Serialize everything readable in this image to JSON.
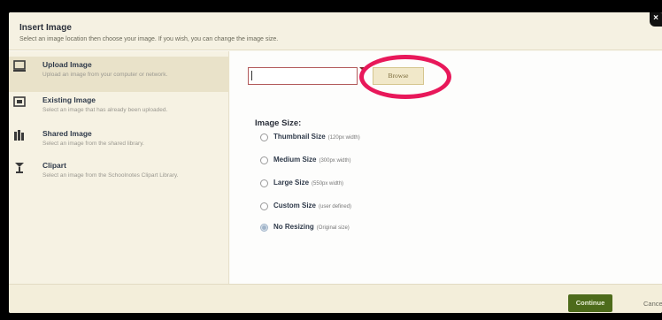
{
  "dialog": {
    "title": "Insert Image",
    "subtitle": "Select an image location then choose your image. If you wish, you can change the image size.",
    "close_label": "×"
  },
  "sidebar": {
    "items": [
      {
        "label": "Upload Image",
        "desc": "Upload an image from your computer or network.",
        "icon": "monitor-icon"
      },
      {
        "label": "Existing Image",
        "desc": "Select an image that has already been uploaded.",
        "icon": "image-icon"
      },
      {
        "label": "Shared Image",
        "desc": "Select an image from the shared library.",
        "icon": "library-icon"
      },
      {
        "label": "Clipart",
        "desc": "Select an image from the Schoolnotes Clipart Library.",
        "icon": "clipart-icon"
      }
    ]
  },
  "upload": {
    "file_value": "",
    "browse_label": "Browse"
  },
  "image_size": {
    "title": "Image Size:",
    "options": [
      {
        "label": "Thumbnail Size",
        "hint": "(120px width)",
        "checked": false
      },
      {
        "label": "Medium Size",
        "hint": "(300px width)",
        "checked": false
      },
      {
        "label": "Large Size",
        "hint": "(550px width)",
        "checked": false
      },
      {
        "label": "Custom Size",
        "hint": "(user defined)",
        "checked": false
      },
      {
        "label": "No Resizing",
        "hint": "(Original size)",
        "checked": true
      }
    ]
  },
  "footer": {
    "continue_label": "Continue",
    "cancel_label": "Cancel"
  },
  "colors": {
    "accent_green": "#4d6b1b",
    "highlight_ring": "#e8185a",
    "header_bg": "#f5f1e2"
  }
}
